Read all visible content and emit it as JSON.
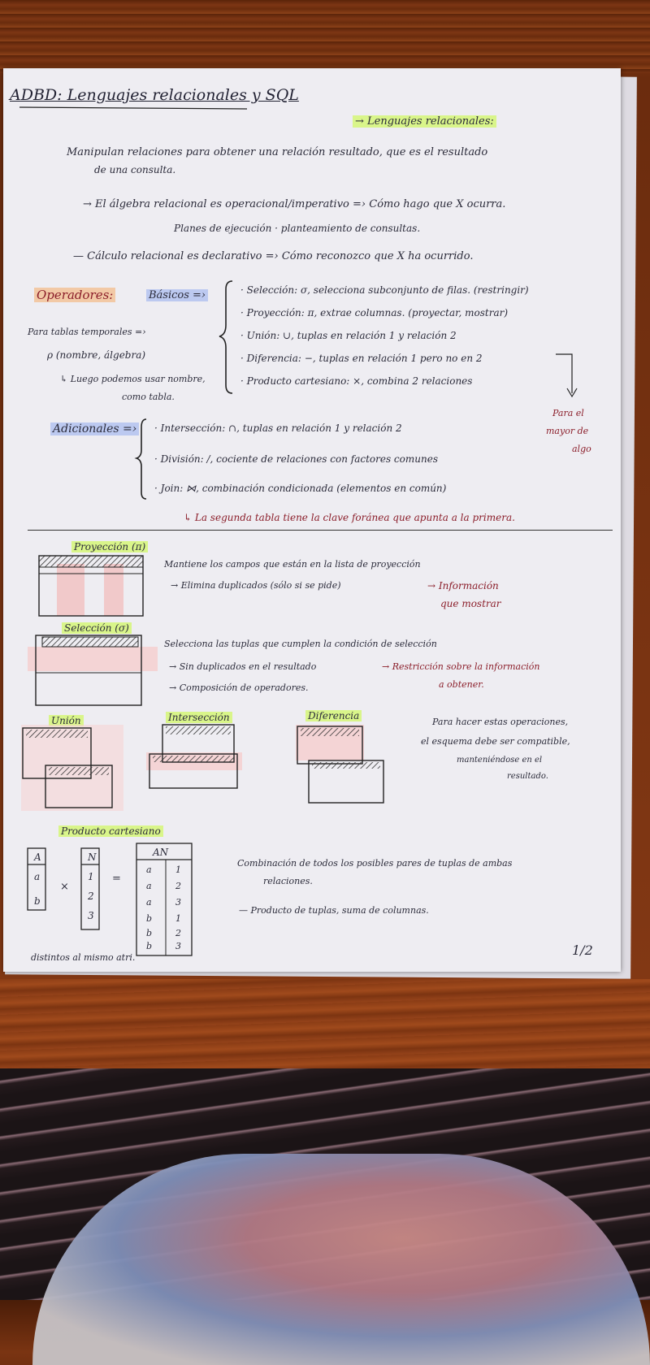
{
  "title": "ADBD: Lenguajes relacionales y SQL",
  "side_heading": "→ Lenguajes relacionales:",
  "intro_line1": "Manipulan relaciones para obtener una relación resultado, que es el resultado",
  "intro_line2": "de una consulta.",
  "algebra_line1": "→ El álgebra relacional es operacional/imperativo =› Cómo hago que X ocurra.",
  "algebra_line2": "Planes de ejecución · planteamiento de consultas.",
  "calculo_line": "— Cálculo relacional es declarativo =› Cómo reconozco que X ha ocurrido.",
  "operators_label": "Operadores:",
  "basic_label": "Básicos =›",
  "basic_ops": [
    "· Selección: σ, selecciona subconjunto de filas. (restringir)",
    "· Proyección: π, extrae columnas. (proyectar, mostrar)",
    "· Unión: ∪, tuplas en relación 1 y relación 2",
    "· Diferencia: −, tuplas en relación 1 pero no en 2",
    "· Producto cartesiano: ×, combina 2 relaciones"
  ],
  "temp_tables_line1": "Para tablas temporales =›",
  "temp_tables_line2": "ρ (nombre, álgebra)",
  "temp_tables_line3": "↳ Luego podemos usar nombre,",
  "temp_tables_line4": "como tabla.",
  "side_note": [
    "Para el",
    "mayor de",
    "algo"
  ],
  "additional_label": "Adicionales =›",
  "additional_ops": [
    "· Intersección: ∩, tuplas en relación 1 y relación 2",
    "· División: /, cociente de relaciones con factores comunes",
    "· Join: ⋈, combinación condicionada (elementos en común)"
  ],
  "join_note": "↳ La segunda tabla tiene la clave foránea que apunta a la primera.",
  "projection_label": "Proyección (π)",
  "projection_text1": "Mantiene los campos que están en la lista de proyección",
  "projection_text2": "→ Elimina duplicados (sólo si se pide)",
  "projection_note1": "→ Información",
  "projection_note2": "que mostrar",
  "selection_label": "Selección (σ)",
  "selection_text1": "Selecciona las tuplas que cumplen la condición de selección",
  "selection_text2": "→ Sin duplicados en el resultado",
  "selection_text3": "→ Composición de operadores.",
  "selection_note1": "→ Restricción sobre la información",
  "selection_note2": "a obtener.",
  "union_label": "Unión",
  "intersection_label": "Intersección",
  "difference_label": "Diferencia",
  "set_ops_note": [
    "Para hacer estas operaciones,",
    "el esquema debe ser compatible,",
    "manteniéndose en el",
    "resultado."
  ],
  "cartesian_label": "Producto cartesiano",
  "table_a": {
    "header": "A",
    "rows": [
      "a",
      "b"
    ]
  },
  "table_n": {
    "header": "N",
    "rows": [
      "1",
      "2",
      "3"
    ]
  },
  "times_sign": "×",
  "equals_sign": "=",
  "table_an": {
    "header": "AN",
    "rows": [
      [
        "a",
        "1"
      ],
      [
        "a",
        "2"
      ],
      [
        "a",
        "3"
      ],
      [
        "b",
        "1"
      ],
      [
        "b",
        "2"
      ],
      [
        "b",
        "3"
      ]
    ]
  },
  "cartesian_text1": "Combinación de todos los posibles pares de tuplas de ambas",
  "cartesian_text2": "relaciones.",
  "cartesian_text3": "— Producto de tuplas, suma de columnas.",
  "bottom_note": "distintos al mismo atri.",
  "page_number": "1/2",
  "colors": {
    "highlight": "#d9f58a",
    "ink": "#2b2b3a",
    "red_ink": "#8b1e2a",
    "paper": "#eeedf2"
  }
}
